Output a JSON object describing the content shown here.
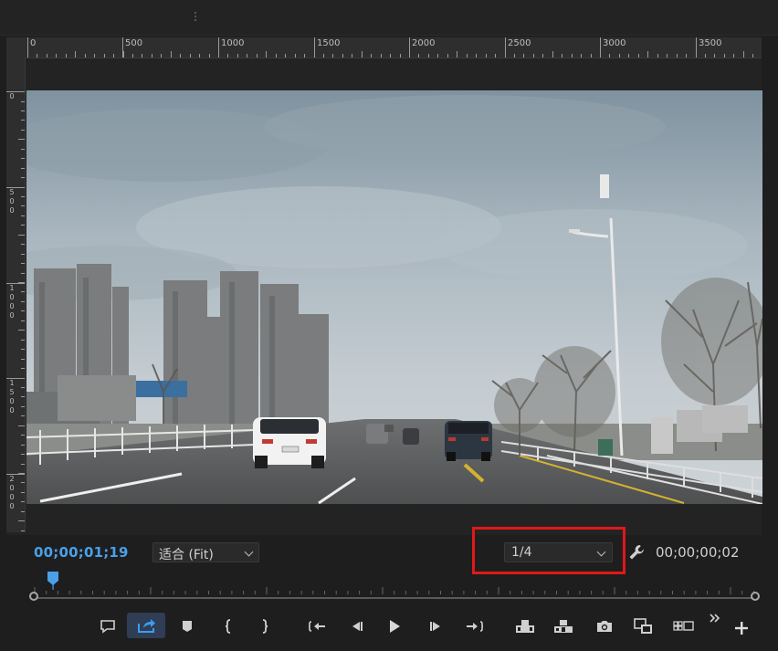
{
  "ruler": {
    "h_labels": [
      "0",
      "500",
      "1000",
      "1500",
      "2000",
      "2500",
      "3000",
      "3500"
    ],
    "v_labels": [
      "0",
      "5\n0\n0",
      "1\n0\n0\n0",
      "1\n5\n0\n0",
      "2\n0\n0\n0"
    ]
  },
  "monitor": {
    "timecode_current": "00;00;01;19",
    "timecode_duration": "00;00;00;02",
    "fit_select": "适合 (Fit)",
    "resolution_select": "1/4",
    "highlight_color": "#e01818",
    "accent_color": "#4aa0e8"
  },
  "toolbar": {
    "buttons": [
      "add-marker-comment",
      "export-frame-active",
      "add-marker",
      "mark-in",
      "mark-out",
      "go-to-in",
      "step-back",
      "play",
      "step-forward",
      "go-to-out",
      "lift",
      "extract",
      "export-frame",
      "comparison-view",
      "multi-camera",
      "more",
      "add-button"
    ]
  }
}
